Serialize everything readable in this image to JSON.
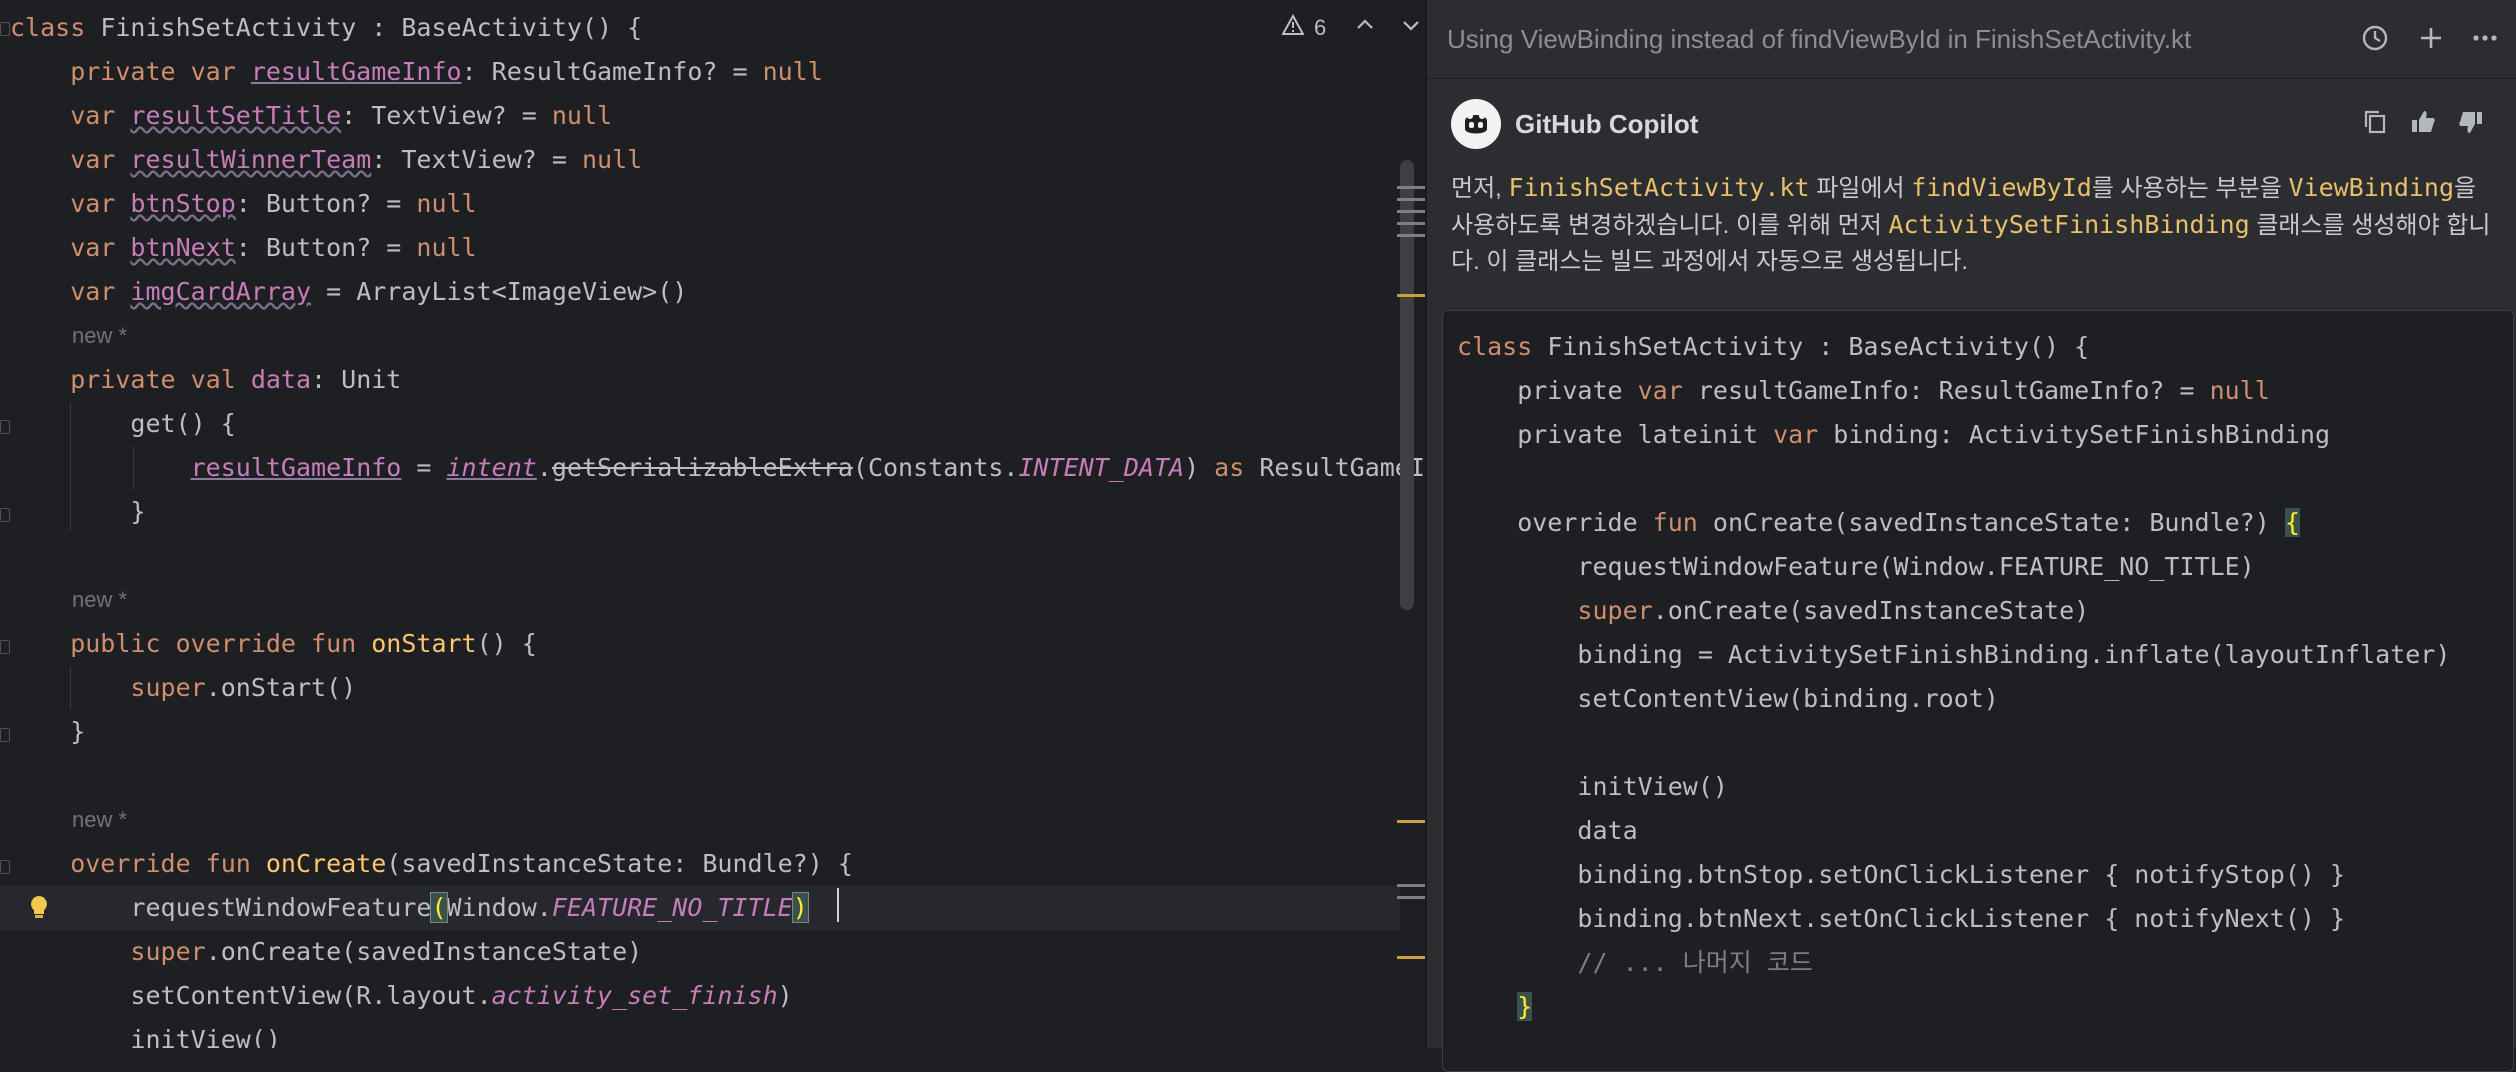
{
  "editor": {
    "inspections_count": "6",
    "inlay_hint": "new *",
    "lines": [
      {
        "parts": [
          {
            "t": "class ",
            "c": "kw"
          },
          {
            "t": "FinishSetActivity : BaseActivity() {",
            "c": "id"
          }
        ]
      },
      {
        "parts": [
          {
            "t": "    private var ",
            "c": "kw"
          },
          {
            "t": "resultGameInfo",
            "c": "prop und"
          },
          {
            "t": ": ResultGameInfo? = ",
            "c": "id"
          },
          {
            "t": "null",
            "c": "kw"
          }
        ]
      },
      {
        "parts": [
          {
            "t": "    var ",
            "c": "kw"
          },
          {
            "t": "resultSetTitle",
            "c": "prop wavy"
          },
          {
            "t": ": TextView? = ",
            "c": "id"
          },
          {
            "t": "null",
            "c": "kw"
          }
        ]
      },
      {
        "parts": [
          {
            "t": "    var ",
            "c": "kw"
          },
          {
            "t": "resultWinnerTeam",
            "c": "prop wavy"
          },
          {
            "t": ": TextView? = ",
            "c": "id"
          },
          {
            "t": "null",
            "c": "kw"
          }
        ]
      },
      {
        "parts": [
          {
            "t": "    var ",
            "c": "kw"
          },
          {
            "t": "btnStop",
            "c": "prop wavy"
          },
          {
            "t": ": Button? = ",
            "c": "id"
          },
          {
            "t": "null",
            "c": "kw"
          }
        ]
      },
      {
        "parts": [
          {
            "t": "    var ",
            "c": "kw"
          },
          {
            "t": "btnNext",
            "c": "prop wavy"
          },
          {
            "t": ": Button? = ",
            "c": "id"
          },
          {
            "t": "null",
            "c": "kw"
          }
        ]
      },
      {
        "parts": [
          {
            "t": "    var ",
            "c": "kw"
          },
          {
            "t": "imgCardArray",
            "c": "prop wavy"
          },
          {
            "t": " = ArrayList<ImageView>()",
            "c": "id"
          }
        ]
      },
      {
        "parts": [
          {
            "t": "    private val ",
            "c": "kw"
          },
          {
            "t": "data",
            "c": "prop"
          },
          {
            "t": ": Unit",
            "c": "id"
          }
        ]
      },
      {
        "parts": [
          {
            "t": "        get() {",
            "c": "id"
          }
        ]
      },
      {
        "parts": [
          {
            "t": "            ",
            "c": "id"
          },
          {
            "t": "resultGameInfo",
            "c": "prop und"
          },
          {
            "t": " = ",
            "c": "id"
          },
          {
            "t": "intent",
            "c": "it und"
          },
          {
            "t": ".",
            "c": "id"
          },
          {
            "t": "getSerializableExtra",
            "c": "id strike"
          },
          {
            "t": "(Constants.",
            "c": "id"
          },
          {
            "t": "INTENT_DATA",
            "c": "it"
          },
          {
            "t": ") ",
            "c": "id"
          },
          {
            "t": "as",
            "c": "kw"
          },
          {
            "t": " ResultGameInfo",
            "c": "id"
          }
        ]
      },
      {
        "parts": [
          {
            "t": "        }",
            "c": "id"
          }
        ]
      },
      {
        "parts": [
          {
            "t": "    public override fun ",
            "c": "kw"
          },
          {
            "t": "onStart",
            "c": "fnd"
          },
          {
            "t": "() {",
            "c": "id"
          }
        ]
      },
      {
        "parts": [
          {
            "t": "        ",
            "c": "id"
          },
          {
            "t": "super",
            "c": "kw"
          },
          {
            "t": ".onStart()",
            "c": "id"
          }
        ]
      },
      {
        "parts": [
          {
            "t": "    }",
            "c": "id"
          }
        ]
      },
      {
        "parts": [
          {
            "t": "    override fun ",
            "c": "kw"
          },
          {
            "t": "onCreate",
            "c": "fnd"
          },
          {
            "t": "(savedInstanceState: Bundle?) {",
            "c": "id"
          }
        ]
      },
      {
        "parts": [
          {
            "t": "        requestWindowFeature",
            "c": "id"
          },
          {
            "t": "(",
            "c": "hl"
          },
          {
            "t": "Window.",
            "c": "id"
          },
          {
            "t": "FEATURE_NO_TITLE",
            "c": "it"
          },
          {
            "t": ")",
            "c": "hl"
          }
        ]
      },
      {
        "parts": [
          {
            "t": "        ",
            "c": "id"
          },
          {
            "t": "super",
            "c": "kw"
          },
          {
            "t": ".onCreate(savedInstanceState)",
            "c": "id"
          }
        ]
      },
      {
        "parts": [
          {
            "t": "        setContentView(R.layout.",
            "c": "id"
          },
          {
            "t": "activity_set_finish",
            "c": "it"
          },
          {
            "t": ")",
            "c": "id"
          }
        ]
      },
      {
        "parts": [
          {
            "t": "        initView()",
            "c": "id"
          }
        ]
      }
    ]
  },
  "panel": {
    "title": "Using ViewBinding instead of findViewById in FinishSetActivity.kt",
    "author": "GitHub Copilot",
    "message": [
      {
        "t": "먼저, ",
        "c": ""
      },
      {
        "t": "FinishSetActivity.kt",
        "c": "ic"
      },
      {
        "t": " 파일에서 ",
        "c": ""
      },
      {
        "t": "findViewById",
        "c": "ic"
      },
      {
        "t": "를 사용하는 부분을 ",
        "c": ""
      },
      {
        "t": "ViewBinding",
        "c": "ic"
      },
      {
        "t": "을 사용하도록 변경하겠습니다. 이를 위해 먼저 ",
        "c": ""
      },
      {
        "t": "ActivitySetFinishBinding",
        "c": "ic"
      },
      {
        "t": " 클래스를 생성해야 합니다. 이 클래스는 빌드 과정에서 자동으로 생성됩니다.",
        "c": ""
      }
    ],
    "code": [
      [
        {
          "t": "class ",
          "c": "kw"
        },
        {
          "t": "FinishSetActivity : BaseActivity() {",
          "c": "id"
        }
      ],
      [
        {
          "t": "    private ",
          "c": "id"
        },
        {
          "t": "var ",
          "c": "kw"
        },
        {
          "t": "resultGameInfo: ResultGameInfo? = ",
          "c": "id"
        },
        {
          "t": "null",
          "c": "kw"
        }
      ],
      [
        {
          "t": "    private lateinit ",
          "c": "id"
        },
        {
          "t": "var ",
          "c": "kw"
        },
        {
          "t": "binding: ActivitySetFinishBinding",
          "c": "id"
        }
      ],
      [
        {
          "t": "",
          "c": "id"
        }
      ],
      [
        {
          "t": "    override ",
          "c": "id"
        },
        {
          "t": "fun ",
          "c": "kw"
        },
        {
          "t": "onCreate(savedInstanceState: Bundle?) ",
          "c": "id"
        },
        {
          "t": "{",
          "c": "brace"
        }
      ],
      [
        {
          "t": "        requestWindowFeature(Window.FEATURE_NO_TITLE)",
          "c": "id"
        }
      ],
      [
        {
          "t": "        ",
          "c": "id"
        },
        {
          "t": "super",
          "c": "kw"
        },
        {
          "t": ".onCreate(savedInstanceState)",
          "c": "id"
        }
      ],
      [
        {
          "t": "        binding = ActivitySetFinishBinding.inflate(layoutInflater)",
          "c": "id"
        }
      ],
      [
        {
          "t": "        setContentView(binding.root)",
          "c": "id"
        }
      ],
      [
        {
          "t": "",
          "c": "id"
        }
      ],
      [
        {
          "t": "        initView()",
          "c": "id"
        }
      ],
      [
        {
          "t": "        data",
          "c": "id"
        }
      ],
      [
        {
          "t": "        binding.btnStop.setOnClickListener { notifyStop() }",
          "c": "id"
        }
      ],
      [
        {
          "t": "        binding.btnNext.setOnClickListener { notifyNext() }",
          "c": "id"
        }
      ],
      [
        {
          "t": "        // ... 나머지 코드",
          "c": "cmt"
        }
      ],
      [
        {
          "t": "    ",
          "c": "id"
        },
        {
          "t": "}",
          "c": "brace"
        }
      ]
    ]
  },
  "icons": {
    "warning": "warning-icon",
    "up": "chevron-up-icon",
    "down": "chevron-down-icon",
    "history": "history-icon",
    "add": "plus-icon",
    "more": "more-icon",
    "copy": "copy-icon",
    "thumbs_up": "thumbs-up-icon",
    "thumbs_down": "thumbs-down-icon",
    "bulb": "lightbulb-icon"
  }
}
